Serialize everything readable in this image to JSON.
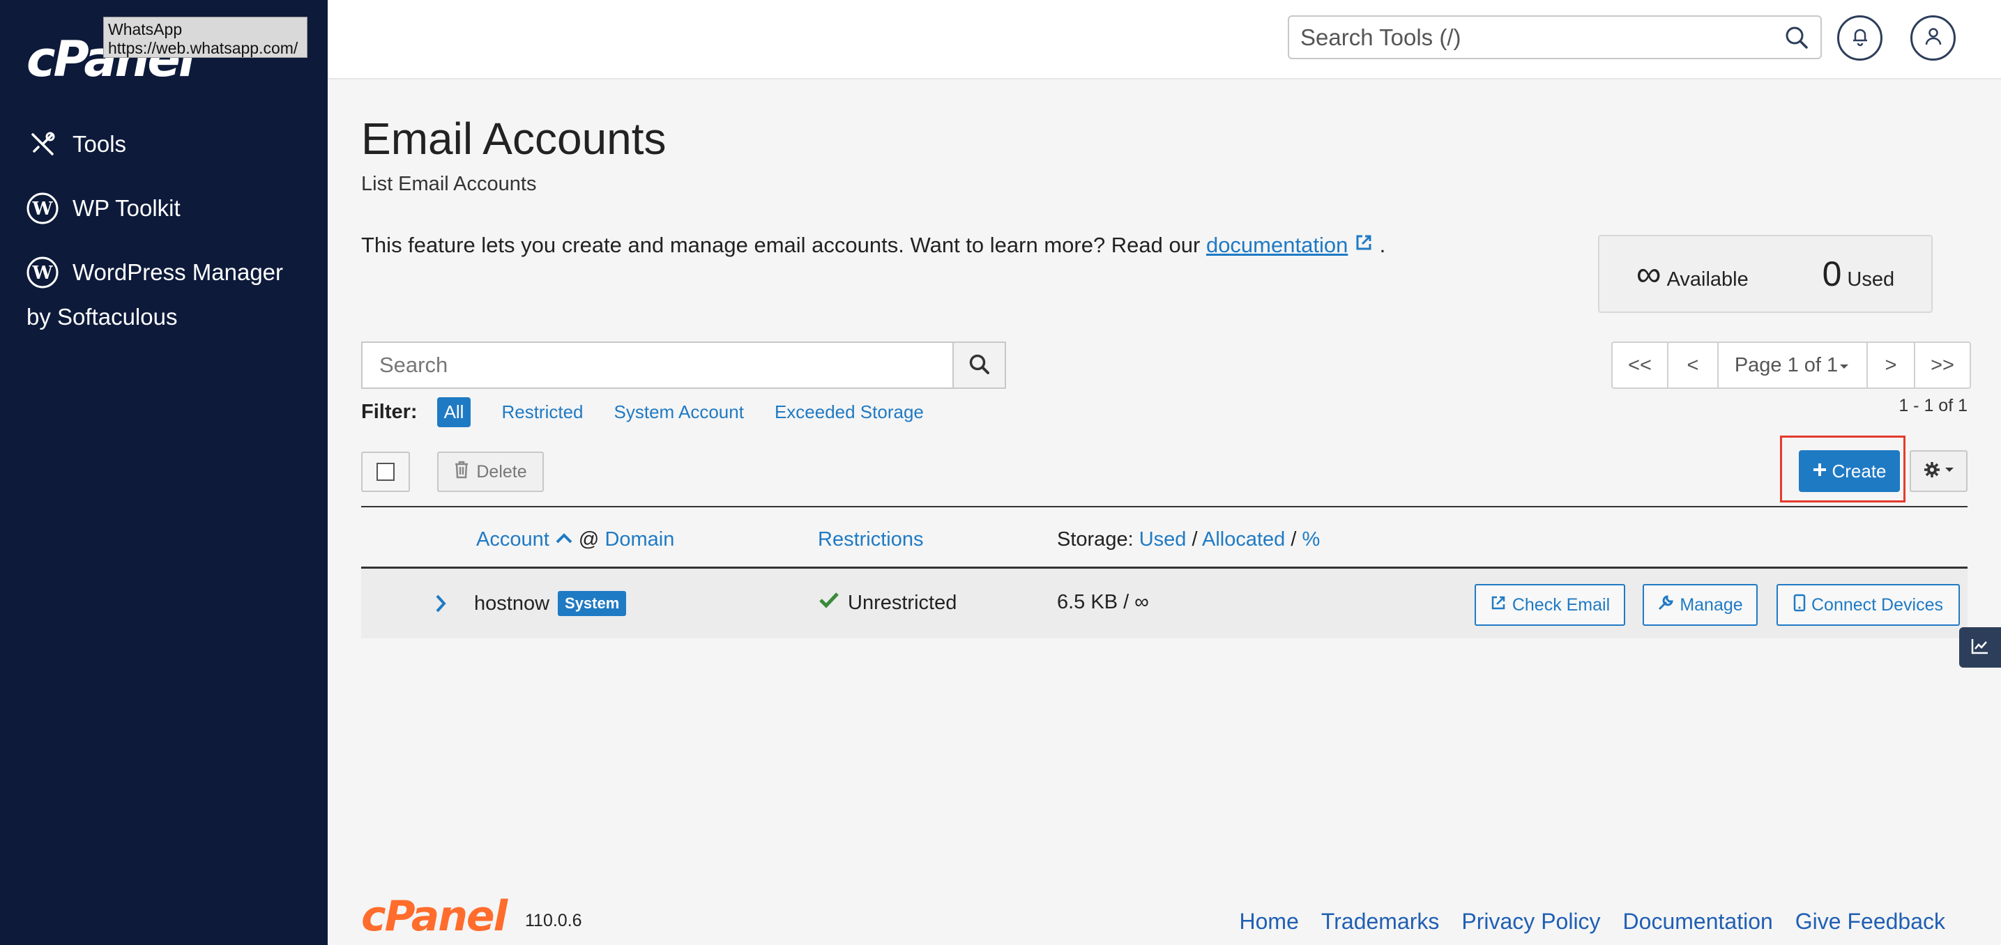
{
  "app": {
    "logo_text": "cPanel",
    "tooltip_title": "WhatsApp",
    "tooltip_url": "https://web.whatsapp.com/"
  },
  "sidebar": {
    "items": [
      {
        "label": "Tools",
        "icon": "tools-icon"
      },
      {
        "label": "WP Toolkit",
        "icon": "wordpress-icon"
      },
      {
        "label": "WordPress Manager",
        "icon": "wordpress-icon"
      }
    ],
    "sub_label": "by Softaculous"
  },
  "header": {
    "search_placeholder": "Search Tools (/)"
  },
  "page": {
    "title": "Email Accounts",
    "subtitle": "List Email Accounts",
    "description": "This feature lets you create and manage email accounts. Want to learn more? Read our",
    "doc_link": "documentation",
    "desc_end": "."
  },
  "stats": {
    "available_value": "∞",
    "available_label": "Available",
    "used_value": "0",
    "used_label": "Used"
  },
  "search": {
    "placeholder": "Search"
  },
  "pager": {
    "first": "<<",
    "prev": "<",
    "page": "Page 1 of 1",
    "next": ">",
    "last": ">>",
    "count": "1 - 1 of 1"
  },
  "filter": {
    "label": "Filter:",
    "options": [
      "All",
      "Restricted",
      "System Account",
      "Exceeded Storage"
    ]
  },
  "toolbar": {
    "delete_label": "Delete",
    "create_label": "Create"
  },
  "table": {
    "headers": {
      "account": "Account",
      "at": "@",
      "domain": "Domain",
      "restrictions": "Restrictions",
      "storage": "Storage:",
      "used": "Used",
      "slash1": "/",
      "allocated": "Allocated",
      "slash2": "/",
      "percent": "%"
    },
    "rows": [
      {
        "account": "hostnow",
        "badge": "System",
        "restriction": "Unrestricted",
        "storage": "6.5 KB / ∞",
        "actions": [
          "Check Email",
          "Manage",
          "Connect Devices"
        ]
      }
    ]
  },
  "footer": {
    "logo_text": "cPanel",
    "version": "110.0.6",
    "links": [
      "Home",
      "Trademarks",
      "Privacy Policy",
      "Documentation",
      "Give Feedback"
    ]
  },
  "colors": {
    "sidebar_bg": "#0d1a3a",
    "accent": "#1f7ac4",
    "brand_orange": "#ff6c2c",
    "highlight_red": "#e53b2c"
  }
}
